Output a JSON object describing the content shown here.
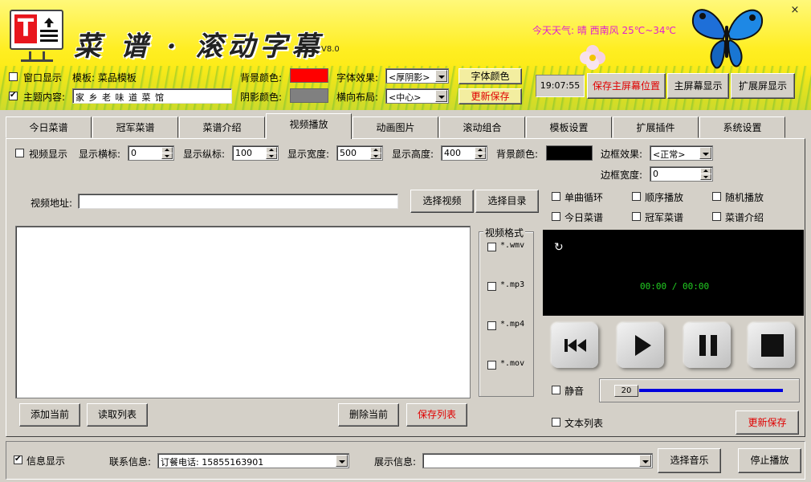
{
  "app": {
    "title": "菜 谱 · 滚动字幕",
    "version": "V8.0",
    "weather": "今天天气: 晴 西南风 25℃~34℃",
    "close_glyph": "×",
    "logo_letter": "T"
  },
  "header": {
    "window_display_label": "窗口显示",
    "window_display_checked": false,
    "template_label": "模板: 菜品模板",
    "topic_label": "主题内容:",
    "topic_checked": true,
    "topic_value": "家 乡 老 味 道 菜 馆",
    "bg_color_label": "背景颜色:",
    "bg_color": "#ff0000",
    "shadow_color_label": "阴影颜色:",
    "shadow_color": "#808080",
    "font_effect_label": "字体效果:",
    "font_effect_value": "<厚阴影>",
    "h_layout_label": "横向布局:",
    "h_layout_value": "<中心>",
    "font_color_btn": "字体颜色",
    "update_save_btn": "更新保存",
    "clock": "19:07:55",
    "save_main_pos_btn": "保存主屏幕位置",
    "main_display_btn": "主屏幕显示",
    "ext_display_btn": "扩展屏显示"
  },
  "tabs": [
    "今日菜谱",
    "冠军菜谱",
    "菜谱介绍",
    "视频播放",
    "动画图片",
    "滚动组合",
    "模板设置",
    "扩展插件",
    "系统设置"
  ],
  "active_tab": "视频播放",
  "video_panel": {
    "video_display_label": "视频显示",
    "x_label": "显示横标:",
    "x_value": "0",
    "y_label": "显示纵标:",
    "y_value": "100",
    "width_label": "显示宽度:",
    "width_value": "500",
    "height_label": "显示高度:",
    "height_value": "400",
    "bg_label": "背景颜色:",
    "bg_color": "#000000",
    "border_effect_label": "边框效果:",
    "border_effect_value": "<正常>",
    "border_width_label": "边框宽度:",
    "border_width_value": "0",
    "url_label": "视频地址:",
    "url_value": "",
    "select_video_btn": "选择视频",
    "select_dir_btn": "选择目录",
    "format_group": "视频格式",
    "formats": [
      "*.wmv",
      "*.mp3",
      "*.mp4",
      "*.mov"
    ],
    "add_current_btn": "添加当前",
    "read_list_btn": "读取列表",
    "delete_current_btn": "删除当前",
    "save_list_btn": "保存列表",
    "options": [
      "单曲循环",
      "顺序播放",
      "随机播放",
      "今日菜谱",
      "冠军菜谱",
      "菜谱介绍"
    ],
    "time_display": "00:00 / 00:00",
    "mute_label": "静音",
    "volume": "20",
    "text_list_label": "文本列表",
    "update_save_btn": "更新保存"
  },
  "footer": {
    "info_display_label": "信息显示",
    "info_display_checked": true,
    "contact_label": "联系信息:",
    "contact_value": "订餐电话: 15855163901",
    "show_label": "展示信息:",
    "show_value": "",
    "select_music_btn": "选择音乐",
    "stop_play_btn": "停止播放"
  }
}
